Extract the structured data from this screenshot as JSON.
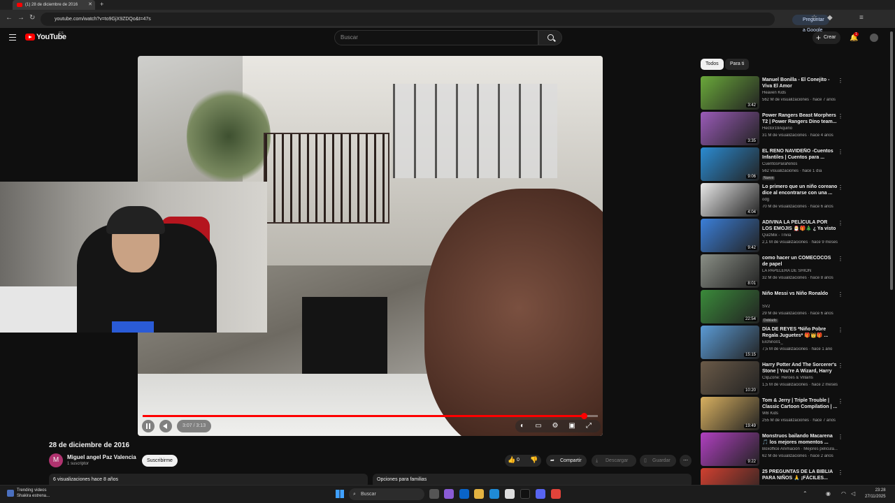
{
  "browser": {
    "tab_title": "(1) 28 de diciembre de 2016",
    "url": "youtube.com/watch?v=to9GjX9ZDQo&t=47s",
    "ask_google": "Preguntar a Google"
  },
  "header": {
    "logo": "YouTube",
    "logo_sup": "ES",
    "search_placeholder": "Buscar",
    "create_label": "Crear",
    "notif_count": "1"
  },
  "player": {
    "time": "3:07 / 3:13",
    "progress": 0.97
  },
  "video": {
    "title": "28 de diciembre de 2016",
    "channel": "Miguel angel Paz Valencia",
    "avatar_letter": "M",
    "subs": "1 suscriptor",
    "subscribe": "Suscribirme",
    "likes": "0",
    "share": "Compartir",
    "download": "Descargar",
    "save": "Guardar",
    "views": "6 visualizaciones  hace 8 años",
    "family": "Opciones para familias"
  },
  "sidebar": {
    "chips": [
      "Todos",
      "Para ti"
    ],
    "items": [
      {
        "title": "Manuel Bonilla - El Conejito - Viva El Amor",
        "channel": "Heaven Kids",
        "meta": "562 M de visualizaciones · hace 7 años",
        "duration": "3:42",
        "color": "#6aa83a",
        "badge": ""
      },
      {
        "title": "Power Rangers Beast Morphers T2 | Power Rangers Dino team...",
        "channel": "Hector19Aquino",
        "meta": "31 M de visualizaciones · hace 4 años",
        "duration": "3:35",
        "color": "#9a5bb8",
        "badge": ""
      },
      {
        "title": "EL RENO NAVIDEÑO -Cuentos Infantiles | Cuentos para ...",
        "channel": "CuentosParaNiños",
        "meta": "562 visualizaciones · hace 1 día",
        "duration": "9:06",
        "color": "#2b8bd1",
        "badge": "Nuevo"
      },
      {
        "title": "Lo primero que un niño coreano dice al encontrarse con una ...",
        "channel": "odg",
        "meta": "70 M de visualizaciones · hace 6 años",
        "duration": "4:04",
        "color": "#e8e8e8",
        "badge": ""
      },
      {
        "title": "ADIVINA LA PELÍCULA POR LOS EMOJIS 🎅🎁🎄 ¿ Ya visto a ...",
        "channel": "QuizMix - Trivia",
        "meta": "2,1 M de visualizaciones · hace 9 meses",
        "duration": "9:42",
        "color": "#3b7fd9",
        "badge": ""
      },
      {
        "title": "como hacer un COMECOCOS de papel",
        "channel": "LA PAPELERA DE SHION",
        "meta": "32 M de visualizaciones · hace 8 años",
        "duration": "8:01",
        "color": "#8a8f86",
        "badge": ""
      },
      {
        "title": "Niño Messi vs Niño Ronaldo",
        "channel": "SV2",
        "meta": "29 M de visualizaciones · hace 6 años",
        "duration": "22:54",
        "color": "#3a8a3a",
        "badge": "Doblado"
      },
      {
        "title": "DÍA DE REYES *Niño Pobre Regala Juguetes* 🎁👑🎁 ...",
        "channel": "Elchino01_",
        "meta": "7,5 M de visualizaciones · hace 1 año",
        "duration": "15:15",
        "color": "#5b9bd5",
        "badge": ""
      },
      {
        "title": "Harry Potter And The Sorcerer's Stone | You're A Wizard, Harry |...",
        "channel": "ClipZone: Heroes & Villains",
        "meta": "1,5 M de visualizaciones · hace 2 meses",
        "duration": "10:20",
        "color": "#6a5a48",
        "badge": ""
      },
      {
        "title": "Tom & Jerry | Triple Trouble | Classic Cartoon Compilation | ...",
        "channel": "WB Kids",
        "meta": "255 M de visualizaciones · hace 7 años",
        "duration": "19:49",
        "color": "#d8b060",
        "badge": ""
      },
      {
        "title": "Monstruos bailando Macarena 🎵 los mejores momentos ...",
        "channel": "Boxoffice Animación · Mejores película...",
        "meta": "62 M de visualizaciones · hace 2 años",
        "duration": "9:22",
        "color": "#b040c0",
        "badge": ""
      },
      {
        "title": "25 PREGUNTAS DE LA BIBLIA PARA NIÑOS 🙏 ¡FÁCILES...",
        "channel": "",
        "meta": "",
        "duration": "",
        "color": "#d04030",
        "badge": ""
      }
    ]
  },
  "taskbar": {
    "news_title": "Trending videos",
    "news_sub": "Shakira estrena...",
    "search": "Buscar",
    "time": "23:28",
    "date": "27/11/2025"
  }
}
